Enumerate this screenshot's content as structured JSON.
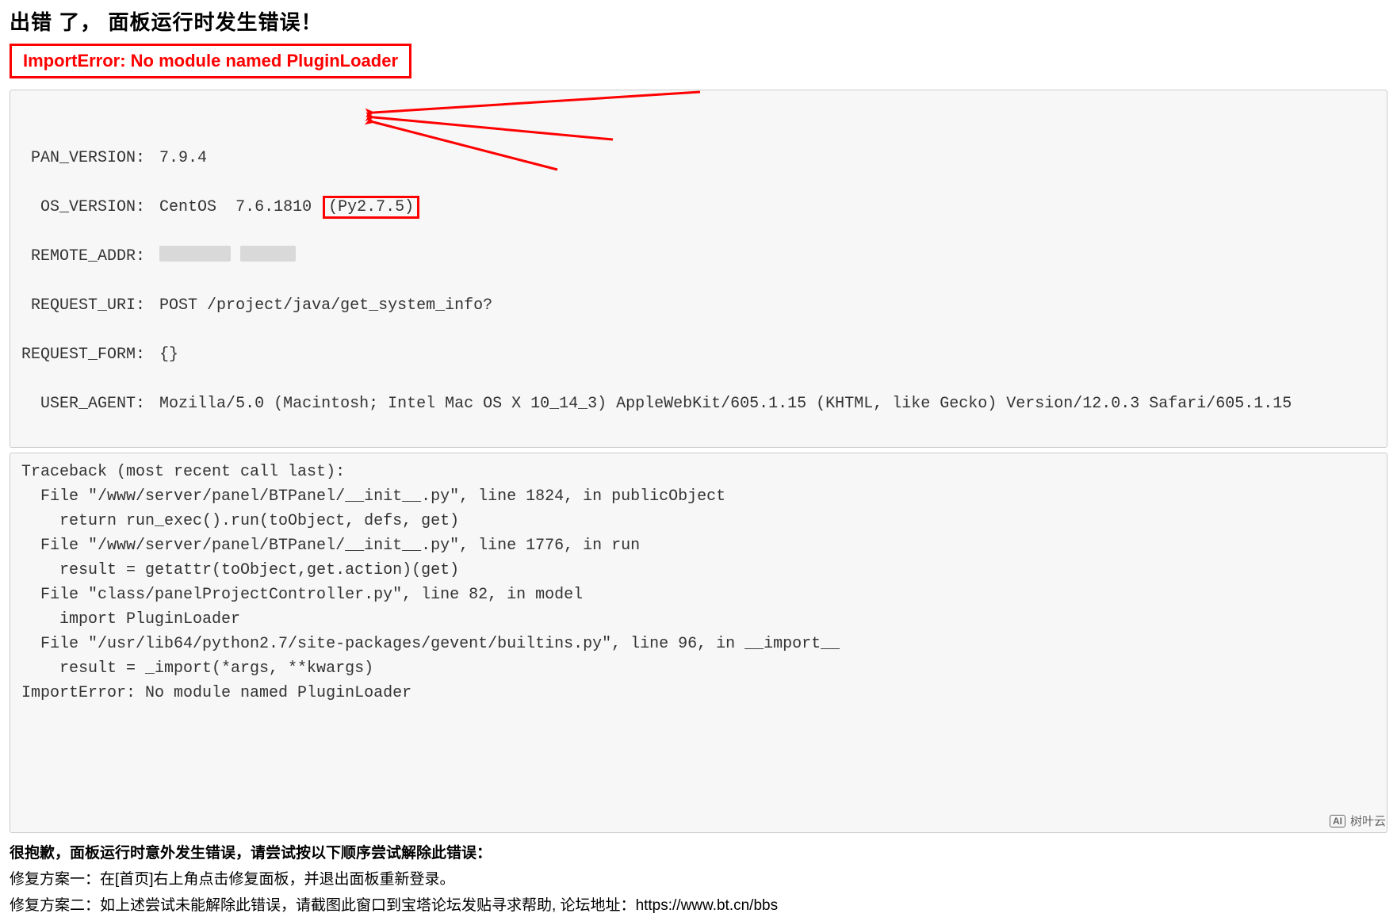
{
  "title": "出错 了， 面板运行时发生错误！",
  "error_summary": "ImportError: No module named PluginLoader",
  "info": {
    "pan_version_label": " PAN_VERSION:",
    "pan_version": "7.9.4",
    "os_version_label": "  OS_VERSION:",
    "os_version_main": "CentOS  7.6.1810",
    "os_version_py": "(Py2.7.5)",
    "remote_addr_label": " REMOTE_ADDR:",
    "request_uri_label": " REQUEST_URI:",
    "request_uri": "POST /project/java/get_system_info?",
    "request_form_label": "REQUEST_FORM:",
    "request_form": "{}",
    "user_agent_label": "  USER_AGENT:",
    "user_agent": "Mozilla/5.0 (Macintosh; Intel Mac OS X 10_14_3) AppleWebKit/605.1.15 (KHTML, like Gecko) Version/12.0.3 Safari/605.1.15"
  },
  "traceback": "Traceback (most recent call last):\n  File \"/www/server/panel/BTPanel/__init__.py\", line 1824, in publicObject\n    return run_exec().run(toObject, defs, get)\n  File \"/www/server/panel/BTPanel/__init__.py\", line 1776, in run\n    result = getattr(toObject,get.action)(get)\n  File \"class/panelProjectController.py\", line 82, in model\n    import PluginLoader\n  File \"/usr/lib64/python2.7/site-packages/gevent/builtins.py\", line 96, in __import__\n    result = _import(*args, **kwargs)\nImportError: No module named PluginLoader",
  "apology": "很抱歉，面板运行时意外发生错误，请尝试按以下顺序尝试解除此错误：",
  "fix1": "修复方案一：在[首页]右上角点击修复面板，并退出面板重新登录。",
  "fix2_prefix": "修复方案二：如上述尝试未能解除此错误，请截图此窗口到宝塔论坛发贴寻求帮助, 论坛地址：",
  "fix2_url": "https://www.bt.cn/bbs",
  "watermark": {
    "badge": "AI",
    "text": "树叶云"
  }
}
